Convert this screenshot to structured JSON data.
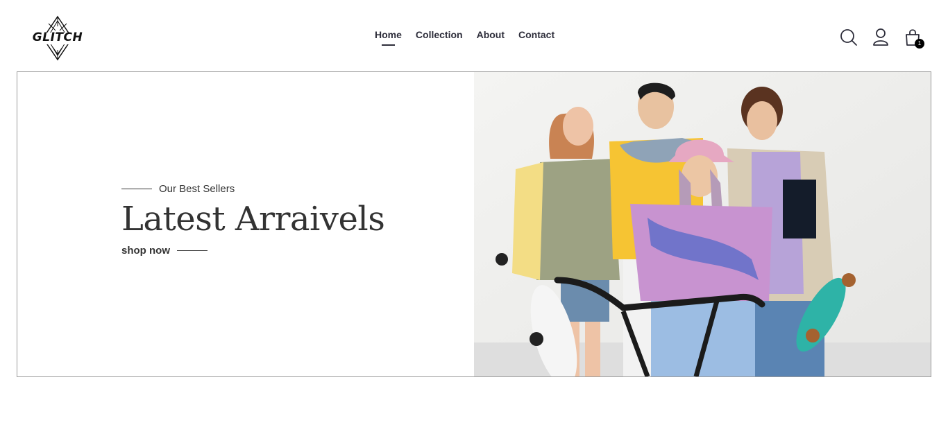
{
  "brand": {
    "name": "GLITCH"
  },
  "nav": {
    "items": [
      {
        "label": "Home",
        "active": true
      },
      {
        "label": "Collection",
        "active": false
      },
      {
        "label": "About",
        "active": false
      },
      {
        "label": "Contact",
        "active": false
      }
    ]
  },
  "header_icons": {
    "search": "search-icon",
    "account": "user-icon",
    "cart": "shopping-bag-icon",
    "cart_count": "1"
  },
  "hero": {
    "eyebrow": "Our Best Sellers",
    "title": "Latest Arraivels",
    "cta": "shop now"
  },
  "colors": {
    "text": "#333333",
    "nav": "#2d2d3a",
    "border": "#9a9a9a",
    "badge": "#000000"
  }
}
